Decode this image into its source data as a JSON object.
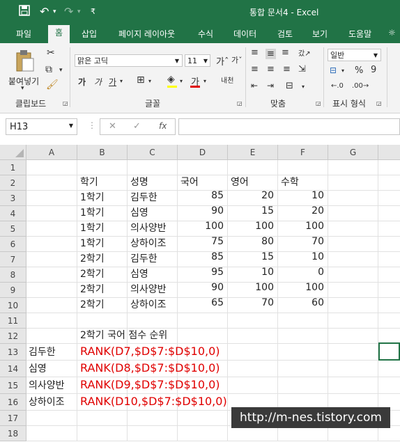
{
  "window": {
    "title": "통합 문서4  -  Excel"
  },
  "tabs": [
    "파일",
    "홈",
    "삽입",
    "페이지 레이아웃",
    "수식",
    "데이터",
    "검토",
    "보기",
    "도움말"
  ],
  "ribbon": {
    "paste_label": "붙여넣기",
    "groups": [
      "클립보드",
      "글꼴",
      "맞춤",
      "표시 형식"
    ],
    "font_name": "맑은 고딕",
    "font_size": "11",
    "number_format": "일반",
    "bold": "가",
    "italic": "가",
    "underline": "가",
    "phonetic": "내천",
    "percent": "%",
    "comma": "9"
  },
  "formula_bar": {
    "name_box": "H13",
    "cancel": "✕",
    "enter": "✓",
    "fx": "fx",
    "content": ""
  },
  "columns": [
    "A",
    "B",
    "C",
    "D",
    "E",
    "F",
    "G"
  ],
  "rows": [
    "1",
    "2",
    "3",
    "4",
    "5",
    "6",
    "7",
    "8",
    "9",
    "10",
    "11",
    "12",
    "13",
    "14",
    "15",
    "16",
    "17",
    "18"
  ],
  "table": {
    "headers": [
      "학기",
      "성명",
      "국어",
      "영어",
      "수학"
    ],
    "data": [
      [
        "1학기",
        "김두한",
        "85",
        "20",
        "10"
      ],
      [
        "1학기",
        "심영",
        "90",
        "15",
        "20"
      ],
      [
        "1학기",
        "의사양반",
        "100",
        "100",
        "100"
      ],
      [
        "1학기",
        "상하이조",
        "75",
        "80",
        "70"
      ],
      [
        "2학기",
        "김두한",
        "85",
        "15",
        "10"
      ],
      [
        "2학기",
        "심영",
        "95",
        "10",
        "0"
      ],
      [
        "2학기",
        "의사양반",
        "90",
        "100",
        "100"
      ],
      [
        "2학기",
        "상하이조",
        "65",
        "70",
        "60"
      ]
    ]
  },
  "rank_title": "2학기 국어 점수 순위",
  "rank_rows": [
    {
      "name": "김두한",
      "formula": "RANK(D7,$D$7:$D$10,0)"
    },
    {
      "name": "심영",
      "formula": "RANK(D8,$D$7:$D$10,0)"
    },
    {
      "name": "의사양반",
      "formula": "RANK(D9,$D$7:$D$10,0)"
    },
    {
      "name": "상하이조",
      "formula": "RANK(D10,$D$7:$D$10,0)"
    }
  ],
  "watermark": "http://m-nes.tistory.com",
  "colors": {
    "excel_green": "#217346",
    "formula_red": "#e00000"
  }
}
